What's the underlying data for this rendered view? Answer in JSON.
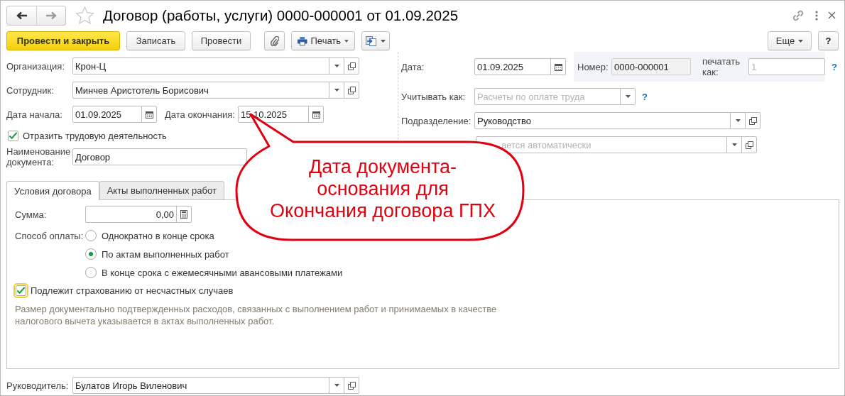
{
  "window": {
    "title": "Договор (работы, услуги) 0000-000001 от 01.09.2025"
  },
  "toolbar": {
    "buttons": [
      {
        "kind": "primary",
        "label": "Провести и закрыть"
      },
      {
        "kind": "plain",
        "label": "Записать"
      },
      {
        "kind": "plain",
        "label": "Провести"
      },
      {
        "kind": "attach"
      },
      {
        "kind": "print",
        "label": "Печать"
      },
      {
        "kind": "export"
      }
    ],
    "more": "Еще",
    "help": "?"
  },
  "organization": {
    "label": "Организация:",
    "value": "Крон-Ц"
  },
  "employee": {
    "label": "Сотрудник:",
    "value": "Минчев Аристотель Борисович"
  },
  "start_date": {
    "label": "Дата начала:",
    "value": "01.09.2025"
  },
  "end_date": {
    "label": "Дата окончания:",
    "value": "15.10.2025"
  },
  "reflect_work": {
    "label": "Отразить трудовую деятельность",
    "checked": true
  },
  "document_name": {
    "label": "Наименование документа:",
    "value": "Договор"
  },
  "date": {
    "label": "Дата:",
    "value": "01.09.2025"
  },
  "number": {
    "label": "Номер:",
    "value": "0000-000001"
  },
  "print_as": {
    "label": "печатать как:",
    "placeholder": "1",
    "help": "?"
  },
  "account_as": {
    "label": "Учитывать как:",
    "placeholder": "Расчеты по оплате труда",
    "help": "?"
  },
  "department": {
    "label": "Подразделение:",
    "value": "Руководство"
  },
  "separate_department": {
    "placeholder": "ается автоматически"
  },
  "tabs": [
    {
      "label": "Условия договора",
      "selected": true
    },
    {
      "label": "Акты выполненных работ",
      "selected": false
    }
  ],
  "amount": {
    "label": "Сумма:",
    "value": "0,00"
  },
  "payment": {
    "label": "Способ оплаты:",
    "options": [
      {
        "label": "Однократно в конце срока",
        "selected": false
      },
      {
        "label": "По актам выполненных работ",
        "selected": true
      },
      {
        "label": "В конце срока с ежемесячными авансовыми платежами",
        "selected": false
      }
    ]
  },
  "insurance": {
    "label": "Подлежит страхованию от несчастных случаев",
    "checked": true
  },
  "note": "Размер документально подтвержденных расходов, связанных с выполнением работ и принимаемых в качестве налогового вычета указывается в актах выполненных работ.",
  "manager": {
    "label": "Руководитель:",
    "value": "Булатов Игорь Виленович"
  },
  "callout": {
    "lines": [
      "Дата документа-",
      "основания для",
      "Окончания договора ГПХ"
    ]
  }
}
